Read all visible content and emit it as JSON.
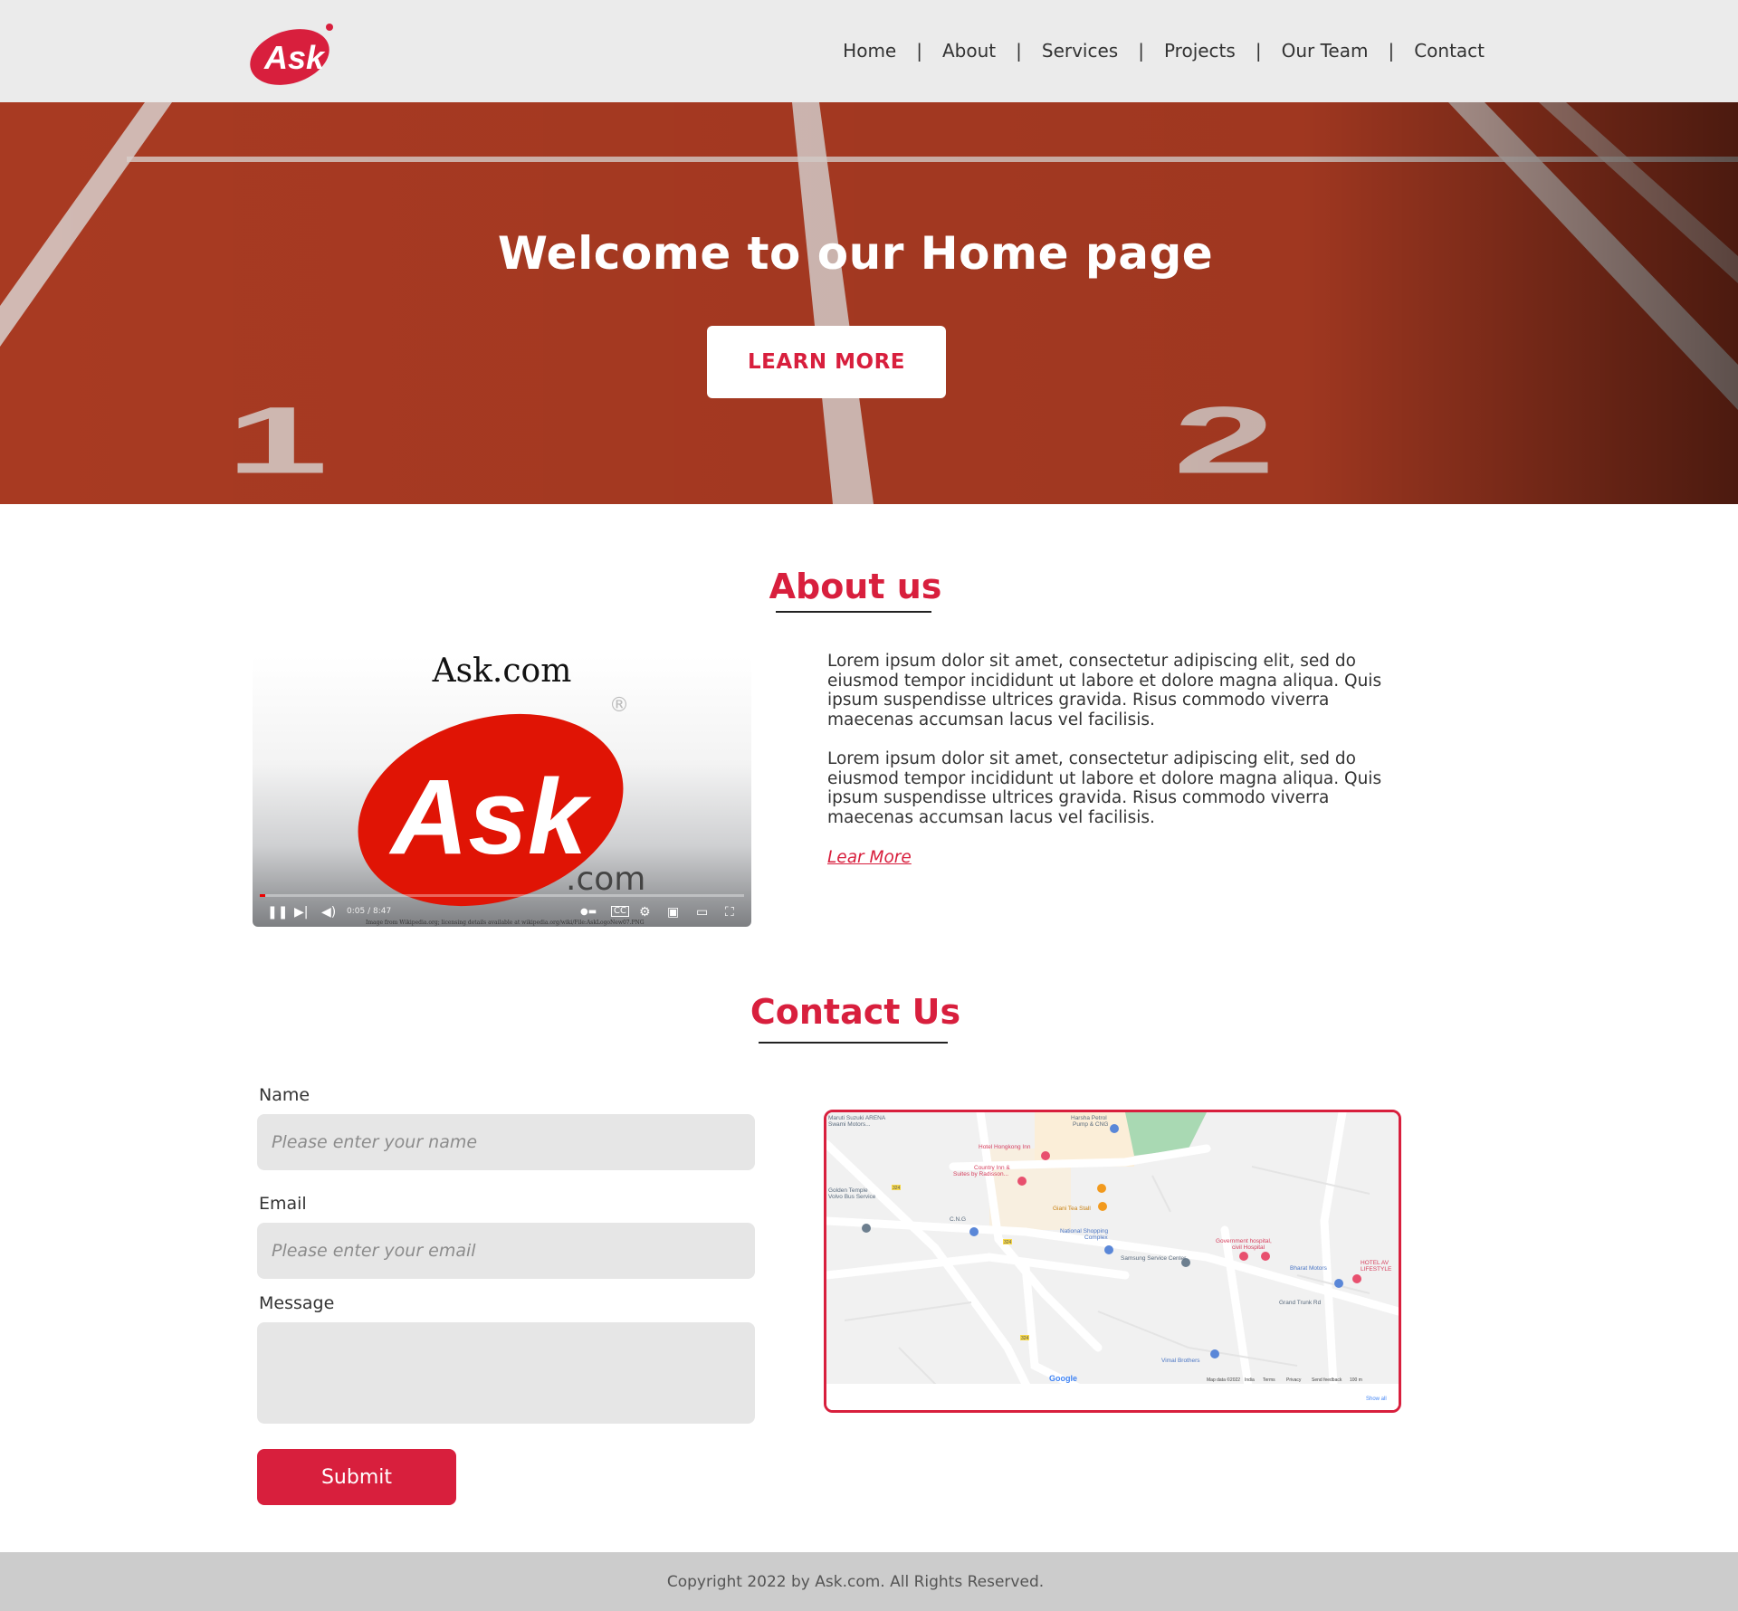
{
  "header": {
    "logo_text": "Ask",
    "nav": [
      "Home",
      "About",
      "Services",
      "Projects",
      "Our Team",
      "Contact"
    ],
    "separator": "|"
  },
  "hero": {
    "title": "Welcome to our Home page",
    "button_label": "LEARN MORE",
    "track_numbers": [
      "1",
      "2"
    ]
  },
  "about": {
    "title": "About us",
    "video": {
      "brand_text": "Ask.com",
      "logo_text": "Ask",
      "dotcom_text": ".com",
      "registered_mark": "®",
      "time": "0:05 / 8:47",
      "credit": "Image from Wikipedia.org; licensing details available at wikipedia.org/wiki/File:AskLogoNew07.PNG",
      "progress": 0.01
    },
    "paragraphs": [
      "Lorem ipsum dolor sit amet, consectetur adipiscing elit, sed do eiusmod tempor incididunt ut labore et dolore magna aliqua. Quis ipsum suspendisse ultrices gravida. Risus commodo viverra maecenas accumsan lacus vel facilisis.",
      "Lorem ipsum dolor sit amet, consectetur adipiscing elit, sed do eiusmod tempor incididunt ut labore et dolore magna aliqua. Quis ipsum suspendisse ultrices gravida. Risus commodo viverra maecenas accumsan lacus vel facilisis."
    ],
    "link_label": "Lear More"
  },
  "contact": {
    "title": "Contact Us",
    "name_label": "Name",
    "name_placeholder": "Please enter your name",
    "email_label": "Email",
    "email_placeholder": "Please enter your email",
    "message_label": "Message",
    "message_value": "",
    "submit_label": "Submit"
  },
  "map": {
    "labels": {
      "maruti": "Maruti Suzuki ARENA",
      "swami": "Swami Motors...",
      "harsha": "Harsha Petrol",
      "pump": "Pump & CNG",
      "hongkong": "Hotel Hongkong Inn",
      "country": "Country Inn &",
      "suites": "Suites by Radisson...",
      "golden": "Golden Temple",
      "volvo": "Volvo Bus Service",
      "giani": "Giani Tea Stall",
      "cng": "C.N.G",
      "national": "National Shopping",
      "complex": "Complex",
      "govt": "Government hospital,",
      "civil": "civil Hospital",
      "samsung": "Samsung Service Center",
      "bharat": "Bharat Motors",
      "hotel_av": "HOTEL AV",
      "lifestyle": "LIFESTYLE",
      "grand_trunk": "Grand Trunk Rd",
      "vimal": "Vimal Brothers",
      "google": "Google",
      "map_data": "Map data ©2022",
      "india": "India",
      "terms": "Terms",
      "privacy": "Privacy",
      "feedback": "Send feedback",
      "scale": "100 m",
      "show_all": "Show all",
      "road_324": "324"
    }
  },
  "footer": {
    "text": "Copyright 2022 by Ask.com. All Rights Reserved."
  },
  "colors": {
    "accent": "#d81f3d",
    "header_bg": "#ebebeb",
    "footer_bg": "#cccccc",
    "track": "#a83a22",
    "field_bg": "#e6e6e6"
  }
}
